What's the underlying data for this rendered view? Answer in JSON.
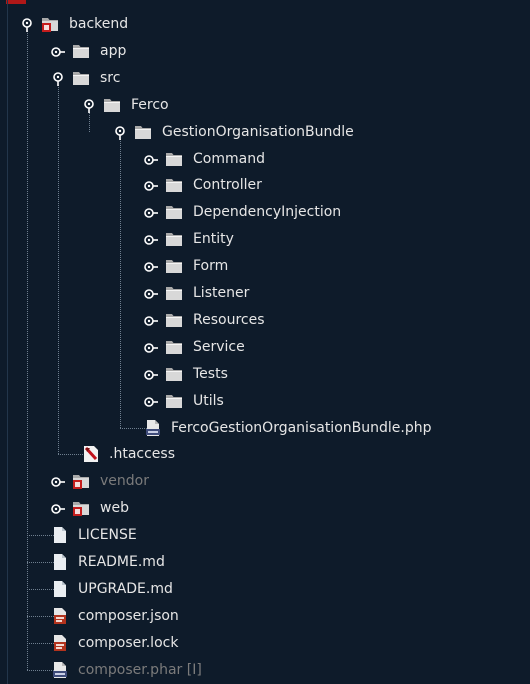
{
  "tree": {
    "rows": [
      {
        "label": "backend",
        "icon": "folder-git",
        "level": 0,
        "expanded": true
      },
      {
        "label": "app",
        "icon": "folder",
        "level": 1,
        "expanded": false
      },
      {
        "label": "src",
        "icon": "folder",
        "level": 1,
        "expanded": true
      },
      {
        "label": "Ferco",
        "icon": "folder",
        "level": 2,
        "expanded": true
      },
      {
        "label": "GestionOrganisationBundle",
        "icon": "folder",
        "level": 3,
        "expanded": true
      },
      {
        "label": "Command",
        "icon": "folder",
        "level": 4,
        "expanded": false
      },
      {
        "label": "Controller",
        "icon": "folder",
        "level": 4,
        "expanded": false
      },
      {
        "label": "DependencyInjection",
        "icon": "folder",
        "level": 4,
        "expanded": false
      },
      {
        "label": "Entity",
        "icon": "folder",
        "level": 4,
        "expanded": false
      },
      {
        "label": "Form",
        "icon": "folder",
        "level": 4,
        "expanded": false
      },
      {
        "label": "Listener",
        "icon": "folder",
        "level": 4,
        "expanded": false
      },
      {
        "label": "Resources",
        "icon": "folder",
        "level": 4,
        "expanded": false
      },
      {
        "label": "Service",
        "icon": "folder",
        "level": 4,
        "expanded": false
      },
      {
        "label": "Tests",
        "icon": "folder",
        "level": 4,
        "expanded": false
      },
      {
        "label": "Utils",
        "icon": "folder",
        "level": 4,
        "expanded": false
      },
      {
        "label": "FercoGestionOrganisationBundle.php",
        "icon": "php-file",
        "level": 4,
        "leaf": true
      },
      {
        "label": ".htaccess",
        "icon": "htaccess-file",
        "level": 2,
        "leaf": true
      },
      {
        "label": "vendor",
        "icon": "folder-git",
        "level": 1,
        "expanded": false,
        "dim": true
      },
      {
        "label": "web",
        "icon": "folder-git",
        "level": 1,
        "expanded": false
      },
      {
        "label": "LICENSE",
        "icon": "text-file",
        "level": 1,
        "leaf": true
      },
      {
        "label": "README.md",
        "icon": "text-file",
        "level": 1,
        "leaf": true
      },
      {
        "label": "UPGRADE.md",
        "icon": "text-file",
        "level": 1,
        "leaf": true
      },
      {
        "label": "composer.json",
        "icon": "js-file",
        "level": 1,
        "leaf": true
      },
      {
        "label": "composer.lock",
        "icon": "js-file",
        "level": 1,
        "leaf": true
      },
      {
        "label": "composer.phar [I]",
        "icon": "php-file",
        "level": 1,
        "leaf": true,
        "dim": true
      }
    ]
  }
}
